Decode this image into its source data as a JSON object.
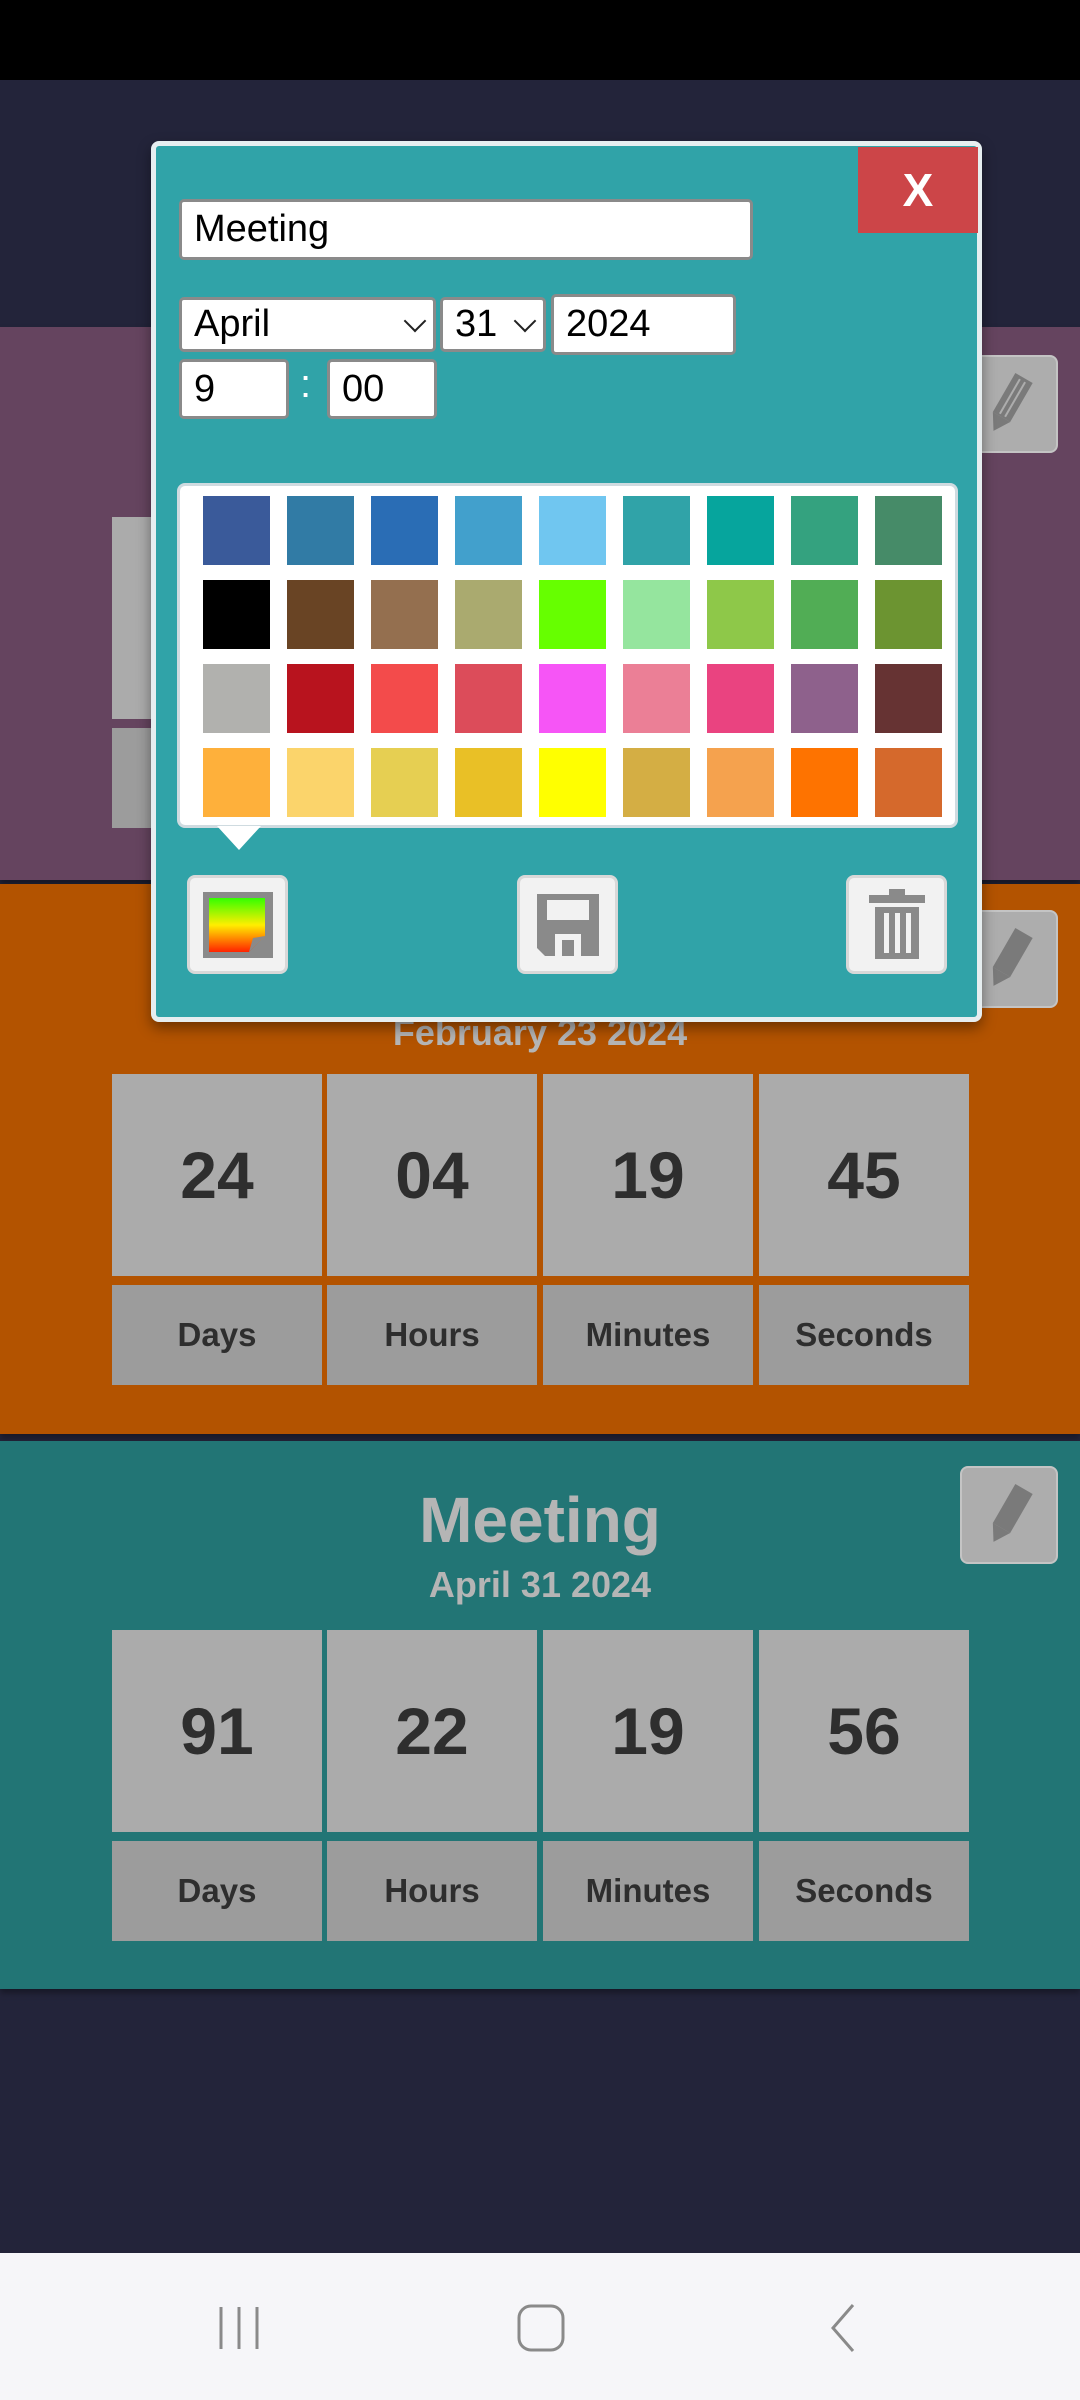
{
  "dialog": {
    "title_value": "Meeting",
    "month_value": "April",
    "day_value": "31",
    "year_value": "2024",
    "hour_value": "9",
    "time_separator": ":",
    "minute_value": "00",
    "close_label": "X",
    "background_color": "#30a3a8",
    "palette": [
      [
        "#3a5a9a",
        "#317ba5",
        "#2a6db5",
        "#42a0cc",
        "#70c6f0",
        "#30a3a8",
        "#06a59d",
        "#34a27f",
        "#468b68"
      ],
      [
        "#000000",
        "#694424",
        "#946f4f",
        "#aaaa6f",
        "#66ff00",
        "#95e59e",
        "#8ec849",
        "#51ad55",
        "#6c9431"
      ],
      [
        "#b1b1ae",
        "#b8131e",
        "#f34b4b",
        "#dc4c5a",
        "#f655f6",
        "#eb7f96",
        "#ea4380",
        "#8e618c",
        "#663333"
      ],
      [
        "#feb03b",
        "#fbd46b",
        "#e6cf52",
        "#e9c026",
        "#ffff00",
        "#d4ae44",
        "#f5a24e",
        "#fe7300",
        "#d5692c"
      ]
    ],
    "buttons": {
      "color": "color-picker-icon",
      "save": "save-icon",
      "delete": "trash-icon"
    }
  },
  "cards": [
    {
      "color": "#65445f"
    },
    {
      "color": "#b35300",
      "date": "February 23 2024",
      "values": [
        "24",
        "04",
        "19",
        "45"
      ],
      "labels": [
        "Days",
        "Hours",
        "Minutes",
        "Seconds"
      ]
    },
    {
      "color": "#227575",
      "title": "Meeting",
      "date": "April 31 2024",
      "values": [
        "91",
        "22",
        "19",
        "56"
      ],
      "labels": [
        "Days",
        "Hours",
        "Minutes",
        "Seconds"
      ]
    }
  ],
  "navbar": {
    "icons": [
      "recent-apps-icon",
      "home-icon",
      "back-icon"
    ]
  }
}
